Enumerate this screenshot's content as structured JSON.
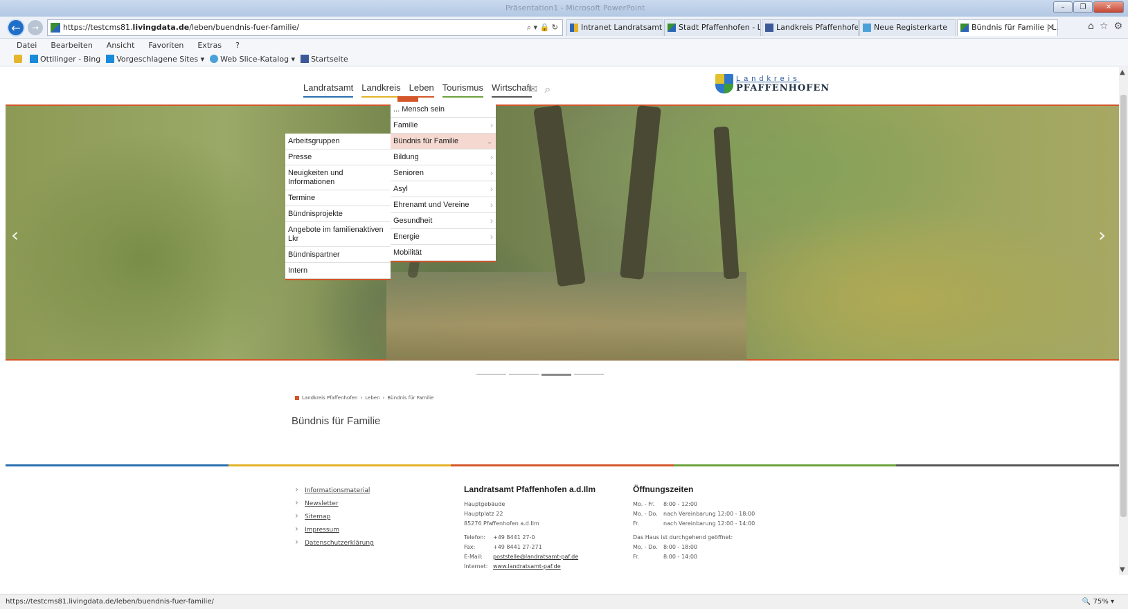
{
  "window": {
    "title": "Präsentation1 - Microsoft PowerPoint"
  },
  "address": {
    "prefix": "https://testcms81.",
    "domain": "livingdata.de",
    "path": "/leben/buendnis-fuer-familie/"
  },
  "tabs": [
    {
      "label": "Intranet Landratsamt Pfaf...",
      "icon": "intranet-icon"
    },
    {
      "label": "Stadt Pfaffenhofen - Lan...",
      "icon": "crest-icon"
    },
    {
      "label": "Landkreis Pfaffenhofen a...",
      "icon": "facebook-icon"
    },
    {
      "label": "Neue Registerkarte",
      "icon": "ie-icon"
    },
    {
      "label": "Bündnis für Familie | L...",
      "icon": "crest-icon",
      "active": true
    }
  ],
  "menubar": [
    "Datei",
    "Bearbeiten",
    "Ansicht",
    "Favoriten",
    "Extras",
    "?"
  ],
  "favorites": [
    {
      "label": "Ottilinger - Bing"
    },
    {
      "label": "Vorgeschlagene Sites ▾"
    },
    {
      "label": "Web Slice-Katalog ▾"
    },
    {
      "label": "Startseite"
    }
  ],
  "nav": [
    {
      "label": "Landratsamt",
      "color": "#2a6fb0"
    },
    {
      "label": "Landkreis",
      "color": "#e3b326"
    },
    {
      "label": "Leben",
      "color": "#d4552a"
    },
    {
      "label": "Tourismus",
      "color": "#6aa23c"
    },
    {
      "label": "Wirtschaft",
      "color": "#555555"
    }
  ],
  "logo": {
    "line1": "Landkreis",
    "line2": "PFAFFENHOFEN"
  },
  "menu_leben": [
    {
      "label": "... Mensch sein",
      "chev": ""
    },
    {
      "label": "Familie",
      "chev": "›"
    },
    {
      "label": "Bündnis für Familie",
      "chev": "⌄",
      "selected": true
    },
    {
      "label": "Bildung",
      "chev": "›"
    },
    {
      "label": "Senioren",
      "chev": "›"
    },
    {
      "label": "Asyl",
      "chev": "›"
    },
    {
      "label": "Ehrenamt und Vereine",
      "chev": "›"
    },
    {
      "label": "Gesundheit",
      "chev": "›"
    },
    {
      "label": "Energie",
      "chev": "›"
    },
    {
      "label": "Mobilität",
      "chev": ""
    }
  ],
  "menu_buendnis": [
    "Arbeitsgruppen",
    "Presse",
    "Neuigkeiten und Informationen",
    "Termine",
    "Bündnisprojekte",
    "Angebote im familienaktiven Lkr",
    "Bündnispartner",
    "Intern"
  ],
  "breadcrumb": [
    "Landkreis Pfaffenhofen",
    "Leben",
    "Bündnis für Familie"
  ],
  "page_title": "Bündnis für Familie",
  "footer_line_colors": [
    "#2a6fb0",
    "#e3b326",
    "#d4552a",
    "#6aa23c",
    "#555555"
  ],
  "footer_links": [
    "Informationsmaterial",
    "Newsletter",
    "Sitemap",
    "Impressum",
    "Datenschutzerklärung"
  ],
  "contact": {
    "heading": "Landratsamt Pfaffenhofen a.d.Ilm",
    "building": "Hauptgebäude",
    "street": "Hauptplatz 22",
    "city": "85276 Pfaffenhofen a.d.Ilm",
    "phone_label": "Telefon:",
    "phone": "+49 8441 27-0",
    "fax_label": "Fax:",
    "fax": "+49 8441 27-271",
    "email_label": "E-Mail:",
    "email": "poststelle@landratsamt-paf.de",
    "web_label": "Internet:",
    "web": "www.landratsamt-paf.de"
  },
  "hours": {
    "heading": "Öffnungszeiten",
    "rows": [
      {
        "day": "Mo. - Fr.",
        "time": "8:00 - 12:00"
      },
      {
        "day": "Mo. - Do.",
        "time": "nach Vereinbarung 12:00 - 18:00"
      },
      {
        "day": "Fr.",
        "time": "nach Vereinbarung 12:00 - 14:00"
      }
    ],
    "note": "Das Haus ist durchgehend geöffnet:",
    "rows2": [
      {
        "day": "Mo. - Do.",
        "time": "8:00 - 18:00"
      },
      {
        "day": "Fr.",
        "time": "8:00 - 14:00"
      }
    ]
  },
  "status": {
    "url": "https://testcms81.livingdata.de/leben/buendnis-fuer-familie/",
    "zoom": "75%"
  }
}
